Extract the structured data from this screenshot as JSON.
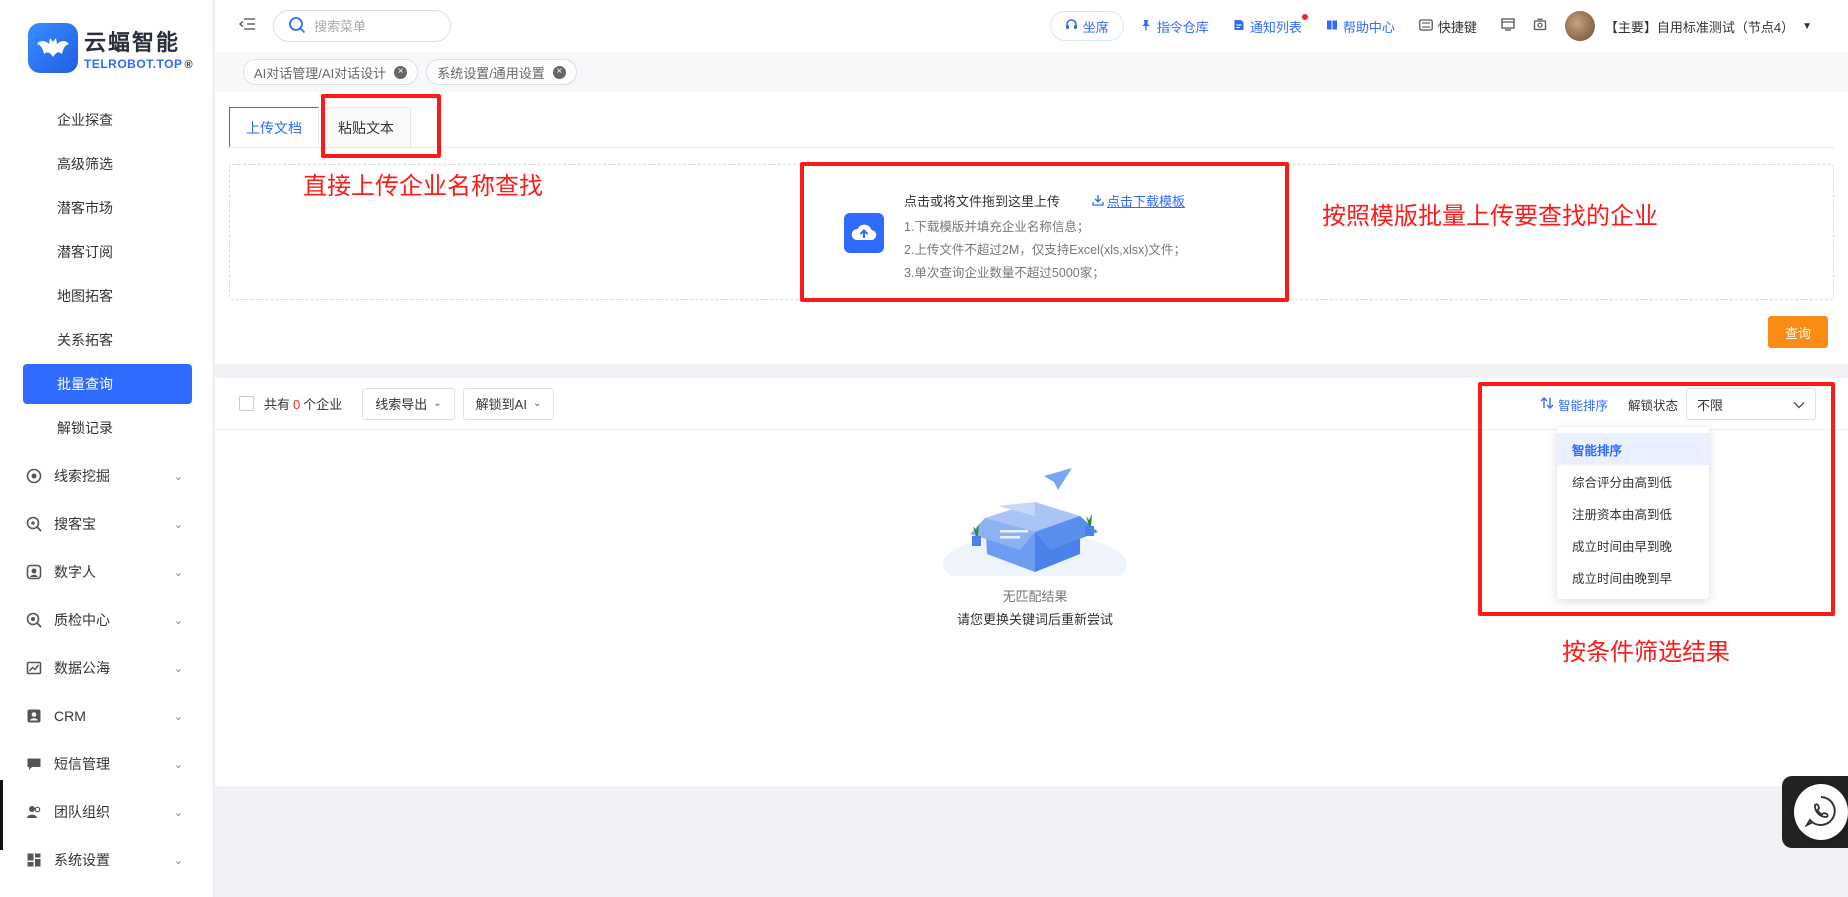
{
  "logo": {
    "cn": "云蝠智能",
    "en": "TELROBOT.TOP",
    "reg": "®"
  },
  "sidebar": {
    "sub_items": [
      "企业探查",
      "高级筛选",
      "潜客市场",
      "潜客订阅",
      "地图拓客",
      "关系拓客",
      "批量查询",
      "解锁记录"
    ],
    "active_item": "批量查询",
    "groups": [
      "线索挖掘",
      "搜客宝",
      "数字人",
      "质检中心",
      "数据公海",
      "CRM",
      "短信管理",
      "团队组织",
      "系统设置"
    ]
  },
  "header": {
    "search_placeholder": "搜索菜单",
    "seat": "坐席",
    "links": [
      "指令仓库",
      "通知列表",
      "帮助中心"
    ],
    "shortcut": "快捷键",
    "account": "【主要】自用标准测试（节点4）"
  },
  "tags": [
    "AI对话管理/AI对话设计",
    "系统设置/通用设置"
  ],
  "upload": {
    "tabs": [
      "上传文档",
      "粘贴文本"
    ],
    "active_tab": "上传文档",
    "title": "点击或将文件拖到这里上传",
    "download_link": "点击下载模板",
    "lines": [
      "1.下载模版并填充企业名称信息；",
      "2.上传文件不超过2M，仅支持Excel(xls,xlsx)文件；",
      "3.单次查询企业数量不超过5000家；"
    ],
    "query_button": "查询"
  },
  "results": {
    "count_prefix": "共有",
    "count": "0",
    "count_suffix": "个企业",
    "export_button": "线索导出",
    "unlock_ai_button": "解锁到AI",
    "sort_label": "智能排序",
    "unlock_status_label": "解锁状态",
    "unlock_status_value": "不限",
    "sort_options": [
      "智能排序",
      "综合评分由高到低",
      "注册资本由高到低",
      "成立时间由早到晚",
      "成立时间由晚到早"
    ],
    "empty_title": "无匹配结果",
    "empty_hint": "请您更换关键词后重新尝试"
  },
  "annotations": {
    "paste_text": "直接上传企业名称查找",
    "template_upload": "按照模版批量上传要查找的企业",
    "filter": "按条件筛选结果"
  },
  "colors": {
    "primary": "#2f6bff",
    "query": "#fa8c16",
    "annotation": "#ff1a1a"
  }
}
